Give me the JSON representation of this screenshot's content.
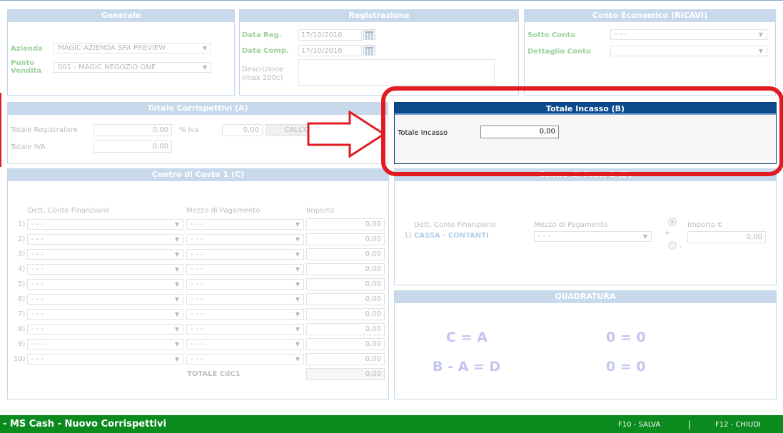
{
  "generale": {
    "title": "Generale",
    "azienda_label": "Azienda",
    "azienda_value": "MAGIC AZIENDA SPA PREVIEW",
    "punto_vendita_label": "Punto Vendita",
    "punto_vendita_value": "001 - MAGIC NEGOZIO ONE"
  },
  "registrazione": {
    "title": "Registrazione",
    "data_reg_label": "Data Reg.",
    "data_reg_value": "17/10/2016",
    "data_comp_label": "Data Comp.",
    "data_comp_value": "17/10/2016",
    "descrizione_label": "Descrizione (max 200c)"
  },
  "conto_economico": {
    "title": "Conto Economico (RICAVI)",
    "sotto_conto_label": "Sotto Conto",
    "sotto_conto_value": "- - -",
    "dettaglio_conto_label": "Dettaglio Conto",
    "dettaglio_conto_value": ""
  },
  "totale_corrispettivi": {
    "title": "Totale Corrispettivi (A)",
    "registratore_label": "Totale Registratore",
    "registratore_value": "0,00",
    "iva_pct_label": "% Iva",
    "iva_pct_value": "0,00",
    "calc_button": "CALCOLA",
    "totale_iva_label": "Totale IVA",
    "totale_iva_value": "0,00"
  },
  "totale_incasso": {
    "title": "Totale Incasso (B)",
    "label": "Totale Incasso",
    "value": "0,00"
  },
  "centro_costo_1": {
    "title": "Centro di Costo 1 (C)",
    "col_conto": "Dett. Conto Finanziario",
    "col_mezzo": "Mezzo di Pagamento",
    "col_importo": "Importo",
    "rows": [
      {
        "n": "1)",
        "conto": "- - -",
        "mezzo": "- - -",
        "importo": "0,00"
      },
      {
        "n": "2)",
        "conto": "- - -",
        "mezzo": "- - -",
        "importo": "0,00"
      },
      {
        "n": "3)",
        "conto": "- - -",
        "mezzo": "- - -",
        "importo": "0,00"
      },
      {
        "n": "4)",
        "conto": "- - -",
        "mezzo": "- - -",
        "importo": "0,00"
      },
      {
        "n": "5)",
        "conto": "- - -",
        "mezzo": "- - -",
        "importo": "0,00"
      },
      {
        "n": "6)",
        "conto": "- - -",
        "mezzo": "- - -",
        "importo": "0,00"
      },
      {
        "n": "7)",
        "conto": "- - -",
        "mezzo": "- - -",
        "importo": "0,00"
      },
      {
        "n": "8)",
        "conto": "- - -",
        "mezzo": "- - -",
        "importo": "0,00"
      },
      {
        "n": "9)",
        "conto": "- - -",
        "mezzo": "- - -",
        "importo": "0,00"
      },
      {
        "n": "10)",
        "conto": "- - -",
        "mezzo": "- - -",
        "importo": "0,00"
      }
    ],
    "totale_label": "TOTALE CdC1",
    "totale_value": "0,00"
  },
  "centro_costo_2": {
    "title": "Centro di Costo 2 (D)",
    "col_conto": "Dett. Conto Finanziario",
    "col_mezzo": "Mezzo di Pagamento",
    "col_importo": "Importo €",
    "row_n": "1)",
    "row_conto": "CASSA - CONTANTI",
    "row_mezzo": "- - -",
    "plus": "+",
    "minus": "-",
    "importo_value": "0,00"
  },
  "quadratura": {
    "title": "QUADRATURA",
    "line1_left": "C = A",
    "line1_right": "0 = 0",
    "line2_left": "B - A = D",
    "line2_right": "0 = 0"
  },
  "footer": {
    "title": "- MS Cash - Nuovo Corrispettivi",
    "salva": "F10 - SALVA",
    "sep": "|",
    "chiudi": "F12 - CHIUDI"
  },
  "colors": {
    "panel_header": "#c7d9ea",
    "active_header": "#0d4a8c",
    "footer": "#0b8a1e",
    "highlight": "#e11b22"
  }
}
